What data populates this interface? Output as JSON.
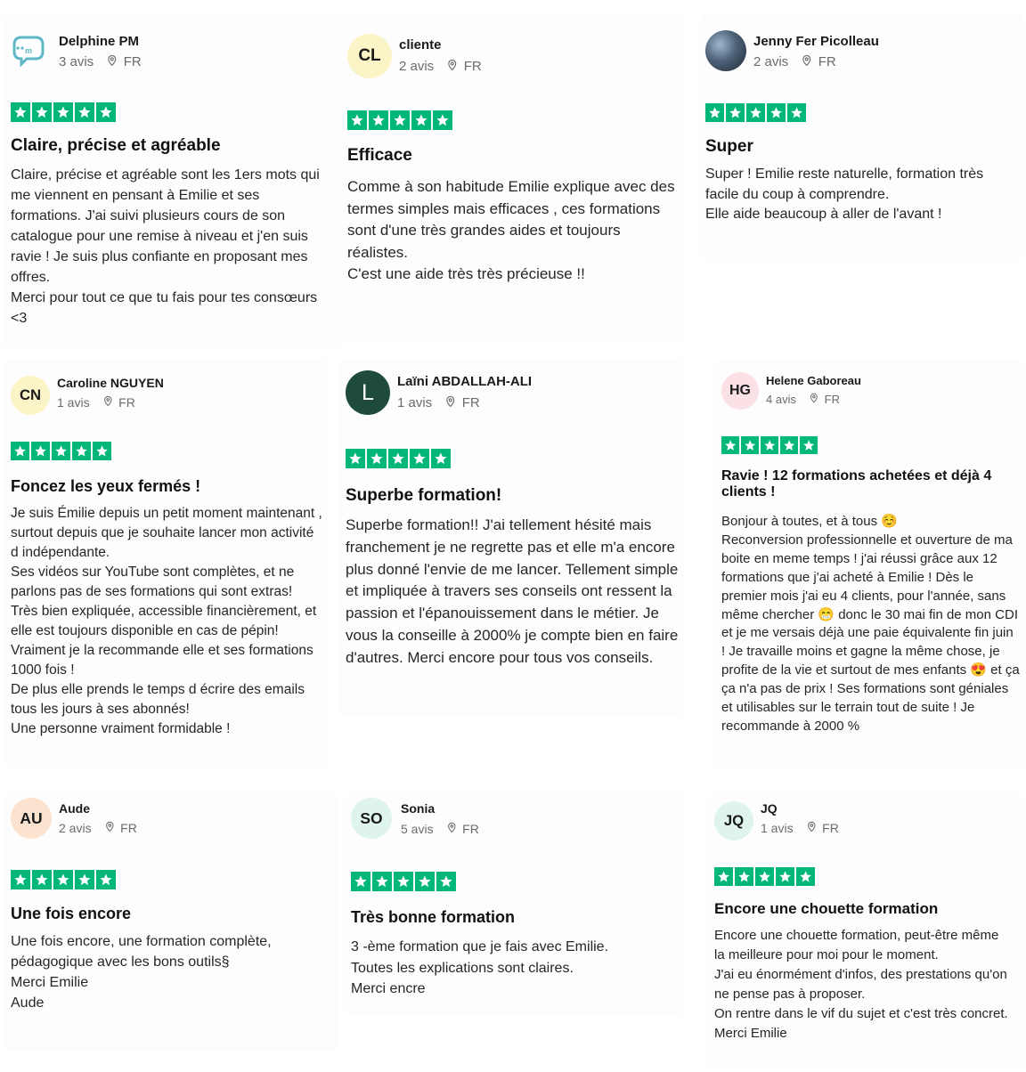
{
  "colors": {
    "star_green": "#00b67a"
  },
  "icons": {
    "location": "location-pin-icon",
    "star": "star-icon"
  },
  "reviews": [
    {
      "name": "Delphine PM",
      "avatar": {
        "type": "logo",
        "initials": "",
        "bg": "#ffffff",
        "logo_text": "ma Page"
      },
      "reviews_count": "3 avis",
      "country": "FR",
      "rating": 5,
      "title": "Claire, précise et agréable",
      "body": "Claire, précise et agréable sont les 1ers mots qui me viennent en pensant à Emilie et ses formations. J'ai suivi plusieurs cours de son catalogue pour une remise à niveau et j'en suis ravie ! Je suis plus confiante en proposant mes offres.\nMerci pour tout ce que tu fais pour tes consœurs <3"
    },
    {
      "name": "cliente",
      "avatar": {
        "type": "initials",
        "initials": "CL",
        "bg": "#fbf4c6"
      },
      "reviews_count": "2 avis",
      "country": "FR",
      "rating": 5,
      "title": "Efficace",
      "body": "Comme à son habitude Emilie explique avec des termes simples mais efficaces , ces formations sont d'une très grandes aides et toujours réalistes.\nC'est une aide très très précieuse !!"
    },
    {
      "name": "Jenny Fer Picolleau",
      "avatar": {
        "type": "photo",
        "initials": "",
        "bg": "#3d4a5a"
      },
      "reviews_count": "2 avis",
      "country": "FR",
      "rating": 5,
      "title": "Super",
      "body": "Super ! Emilie reste naturelle, formation très facile du coup à comprendre.\nElle aide beaucoup à aller de l'avant !"
    },
    {
      "name": "Caroline NGUYEN",
      "avatar": {
        "type": "initials",
        "initials": "CN",
        "bg": "#fbf4c6"
      },
      "reviews_count": "1 avis",
      "country": "FR",
      "rating": 5,
      "title": "Foncez les yeux fermés !",
      "body": "Je suis Émilie depuis un petit moment maintenant , surtout depuis que je souhaite lancer mon activité d indépendante.\nSes vidéos sur YouTube sont complètes, et ne parlons pas de ses formations qui sont extras!\nTrès bien expliquée, accessible financièrement, et elle est toujours disponible en cas de pépin!\nVraiment je la recommande elle et ses formations 1000 fois !\nDe plus elle prends le temps d écrire des emails tous les jours à ses abonnés!\nUne personne vraiment formidable !"
    },
    {
      "name": "Laïni ABDALLAH-ALI",
      "avatar": {
        "type": "initials",
        "initials": "L",
        "bg": "#1f4b3a"
      },
      "reviews_count": "1 avis",
      "country": "FR",
      "rating": 5,
      "title": "Superbe formation!",
      "body": "Superbe formation!! J'ai tellement hésité mais franchement je ne regrette pas et elle m'a encore plus donné l'envie de me lancer. Tellement simple et impliquée à travers ses conseils ont ressent la passion et l'épanouissement dans le métier. Je vous la conseille à 2000% je compte bien en faire d'autres. Merci encore pour tous vos conseils."
    },
    {
      "name": "Helene Gaboreau",
      "avatar": {
        "type": "initials",
        "initials": "HG",
        "bg": "#fbe1e6"
      },
      "reviews_count": "4 avis",
      "country": "FR",
      "rating": 5,
      "title": "Ravie ! 12 formations achetées et déjà 4 clients !",
      "body": "Bonjour à toutes, et à tous ☺️\nReconversion professionnelle et ouverture de ma boite en meme temps ! j'ai réussi grâce aux 12 formations que j'ai acheté à Emilie ! Dès le premier mois j'ai eu 4 clients, pour l'année, sans même chercher 😁 donc le 30 mai fin de mon CDI et je me versais déjà une paie équivalente fin juin ! Je travaille moins et gagne la même chose, je profite de la vie et surtout de mes enfants 😍 et ça ça n'a pas de prix ! Ses formations sont géniales et utilisables sur le terrain tout de suite ! Je recommande à 2000 %"
    },
    {
      "name": "Aude",
      "avatar": {
        "type": "initials",
        "initials": "AU",
        "bg": "#fbe3cf"
      },
      "reviews_count": "2 avis",
      "country": "FR",
      "rating": 5,
      "title": "Une fois encore",
      "body": "Une fois encore, une formation complète, pédagogique avec les bons outils§\nMerci Emilie\nAude"
    },
    {
      "name": "Sonia",
      "avatar": {
        "type": "initials",
        "initials": "SO",
        "bg": "#dff4ea"
      },
      "reviews_count": "5 avis",
      "country": "FR",
      "rating": 5,
      "title": "Très bonne formation",
      "body": "3 -ème formation que je fais avec Emilie.\nToutes les explications sont claires.\nMerci encre"
    },
    {
      "name": "JQ",
      "avatar": {
        "type": "initials",
        "initials": "JQ",
        "bg": "#dff4ea"
      },
      "reviews_count": "1 avis",
      "country": "FR",
      "rating": 5,
      "title": "Encore une chouette formation",
      "body": "Encore une chouette formation, peut-être même la meilleure pour moi pour le moment.\nJ'ai eu énormément d'infos, des prestations qu'on ne pense pas à proposer.\nOn rentre dans le vif du sujet et c'est très concret.\nMerci Emilie"
    }
  ]
}
